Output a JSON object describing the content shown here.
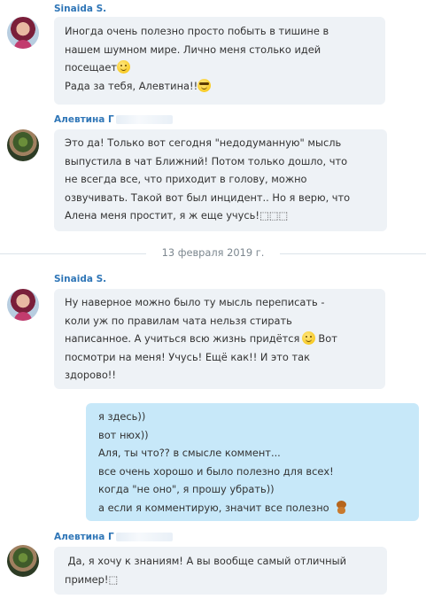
{
  "messages": [
    {
      "author": "Sinaida S.",
      "lines": [
        [
          "Иногда очень полезно просто побыть в тишине в"
        ],
        [
          "нашем шумном мире. Лично меня столько идей"
        ],
        [
          "посещает"
        ],
        [
          "Рада за тебя, Алевтина!!"
        ]
      ]
    },
    {
      "author": "Алевтина Г",
      "lines": [
        [
          "Это да! Только вот сегодня \"недодуманную\" мысль"
        ],
        [
          "выпустила в чат Ближний! Потом только дошло, что"
        ],
        [
          "не всегда все, что приходит в  голову, можно"
        ],
        [
          "озвучивать. Такой вот был инцидент.. Но я верю, что"
        ],
        [
          "Алена меня простит, я ж еще учусь!⬚⬚⬚"
        ]
      ]
    },
    {
      "author": "Sinaida S.",
      "lines": [
        [
          "Ну наверное можно было ту мысль переписать -"
        ],
        [
          "коли уж по правилам чата нельзя стирать"
        ],
        [
          "написанное. А учиться всю жизнь придётся",
          "Вот"
        ],
        [
          "посмотри на меня! Учусь! Ещё как!! И это так"
        ],
        [
          "здорово!!"
        ]
      ]
    },
    {
      "author": "",
      "lines": [
        [
          "я здесь))"
        ],
        [
          "вот нюх))"
        ],
        [
          "Аля, ты что?? в смысле коммент..."
        ],
        [
          "все очень хорошо и было полезно для всех!"
        ],
        [
          "когда \"не оно\", я прошу убрать))"
        ],
        [
          "а если я комментирую, значит все полезно"
        ]
      ]
    },
    {
      "author": "Алевтина Г",
      "lines": [
        [
          " Да, я хочу к знаниям! А вы вообще самый отличный"
        ],
        [
          "пример!⬚"
        ]
      ]
    }
  ],
  "date_separator": "13 февраля 2019 г.",
  "icons": {
    "smile": "smiling-face-emoji",
    "cool": "sunglasses-face-emoji",
    "bear": "teddy-bear-emoji"
  }
}
